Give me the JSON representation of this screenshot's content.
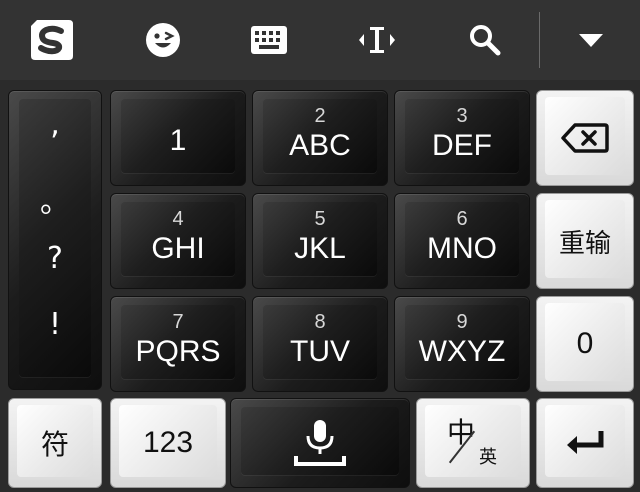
{
  "toolbar": {
    "icons": [
      "sogou-logo-icon",
      "emoji-icon",
      "keyboard-icon",
      "cursor-move-icon",
      "search-icon",
      "collapse-icon"
    ]
  },
  "keys": {
    "punct": [
      ",",
      "。",
      "?",
      "!"
    ],
    "k1": {
      "num": "",
      "letters": "1"
    },
    "k2": {
      "num": "2",
      "letters": "ABC"
    },
    "k3": {
      "num": "3",
      "letters": "DEF"
    },
    "k4": {
      "num": "4",
      "letters": "GHI"
    },
    "k5": {
      "num": "5",
      "letters": "JKL"
    },
    "k6": {
      "num": "6",
      "letters": "MNO"
    },
    "k7": {
      "num": "7",
      "letters": "PQRS"
    },
    "k8": {
      "num": "8",
      "letters": "TUV"
    },
    "k9": {
      "num": "9",
      "letters": "WXYZ"
    },
    "reinput": "重输",
    "zero": "0",
    "symbols": "符",
    "numeric": "123",
    "zh": "中",
    "en": "英"
  },
  "colors": {
    "toolbar_bg": "#333333",
    "keyboard_bg": "#2b2b2b",
    "dark_key": "#1e1e1e",
    "light_key": "#ededed"
  }
}
